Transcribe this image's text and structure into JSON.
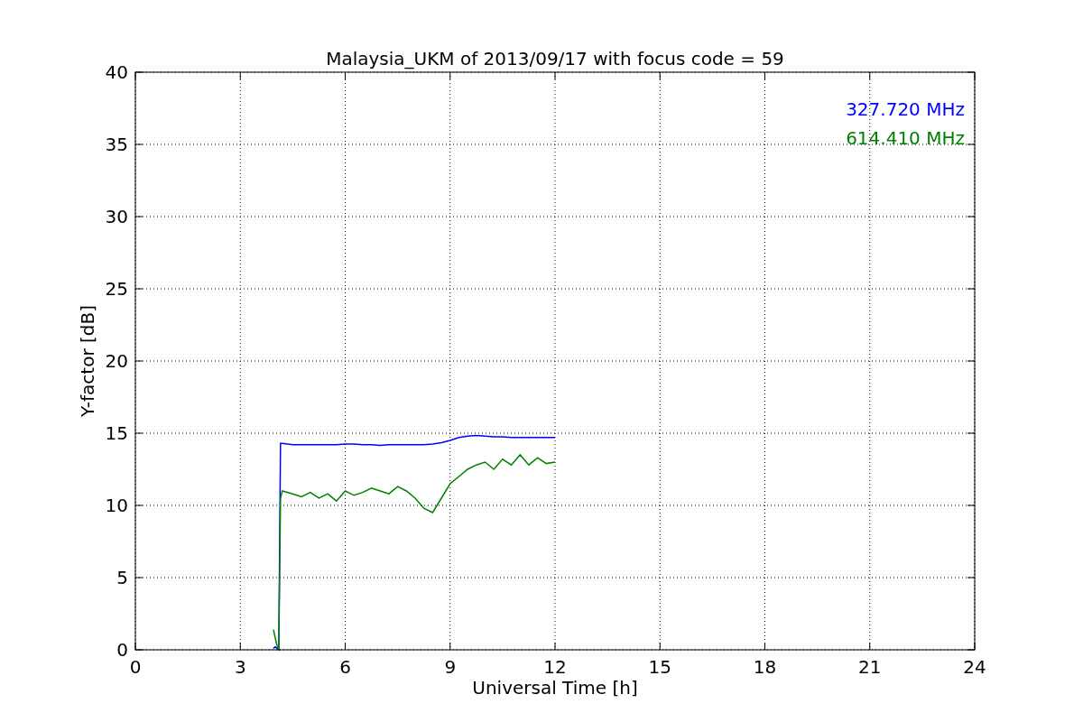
{
  "figure": {
    "chart_data": {
      "type": "line",
      "title": "Malaysia_UKM of 2013/09/17 with focus code = 59",
      "xlabel": "Universal Time [h]",
      "ylabel": "Y-factor [dB]",
      "x": [
        3.95,
        4,
        4.05,
        4.1,
        4.15,
        4.2,
        4.5,
        4.75,
        5,
        5.25,
        5.5,
        5.75,
        6,
        6.25,
        6.5,
        6.75,
        7,
        7.25,
        7.5,
        7.75,
        8,
        8.25,
        8.5,
        8.75,
        9,
        9.25,
        9.5,
        9.75,
        10,
        10.25,
        10.5,
        10.75,
        11,
        11.25,
        11.5,
        11.75,
        12
      ],
      "series": [
        {
          "name": "327.720 MHz",
          "color": "#0000ff",
          "values": [
            0.1,
            0.2,
            0.1,
            0.0,
            14.3,
            14.3,
            14.2,
            14.2,
            14.2,
            14.2,
            14.2,
            14.2,
            14.25,
            14.25,
            14.2,
            14.2,
            14.15,
            14.2,
            14.2,
            14.2,
            14.2,
            14.2,
            14.25,
            14.35,
            14.5,
            14.7,
            14.8,
            14.85,
            14.8,
            14.75,
            14.75,
            14.7,
            14.7,
            14.7,
            14.7,
            14.7,
            14.7
          ]
        },
        {
          "name": "614.410 MHz",
          "color": "#008000",
          "values": [
            1.4,
            0.8,
            0.3,
            0.0,
            10.5,
            11.0,
            10.8,
            10.6,
            10.9,
            10.5,
            10.8,
            10.3,
            11.0,
            10.7,
            10.9,
            11.2,
            11.0,
            10.8,
            11.3,
            11.0,
            10.5,
            9.8,
            9.5,
            10.5,
            11.5,
            12.0,
            12.5,
            12.8,
            13.0,
            12.5,
            13.2,
            12.8,
            13.5,
            12.8,
            13.3,
            12.9,
            13.0
          ]
        }
      ],
      "grid": true,
      "xlim": [
        0,
        24
      ],
      "ylim": [
        0,
        40
      ],
      "xticks": [
        0,
        3,
        6,
        9,
        12,
        15,
        18,
        21,
        24
      ],
      "yticks": [
        0,
        5,
        10,
        15,
        20,
        25,
        30,
        35,
        40
      ]
    }
  }
}
